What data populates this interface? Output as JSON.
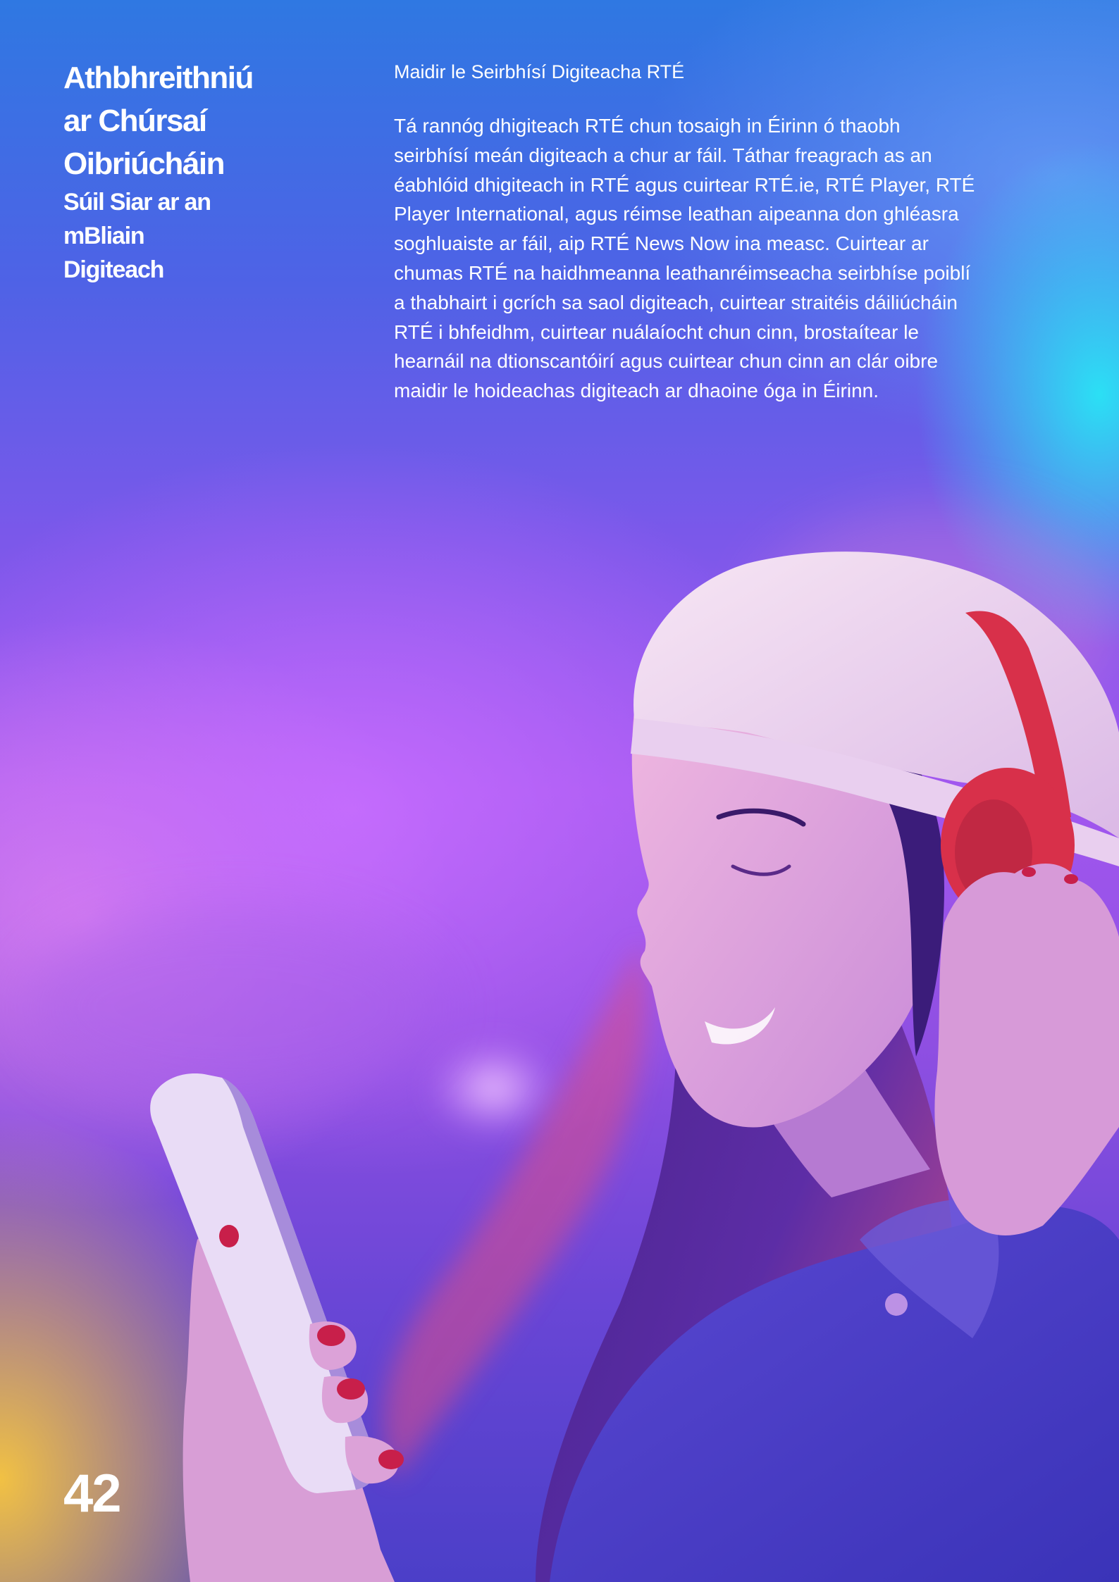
{
  "header": {
    "title_lines": [
      "Athbhreithniú",
      "ar Chúrsaí",
      "Oibriúcháin"
    ],
    "subtitle_lines": [
      "Súil Siar ar an",
      "mBliain",
      "Digiteach"
    ]
  },
  "article": {
    "kicker": "Maidir le Seirbhísí Digiteacha RTÉ",
    "body_lines": [
      "Tá rannóg dhigiteach RTÉ chun tosaigh in Éirinn ó thaobh",
      "seirbhísí meán digiteach a chur ar fáil. Táthar freagrach as an",
      "éabhlóid dhigiteach in RTÉ agus cuirtear RTÉ.ie, RTÉ Player, RTÉ",
      "Player International, agus réimse leathan aipeanna don ghléasra",
      "soghluaiste ar fáil, aip RTÉ News Now ina measc. Cuirtear ar",
      "chumas RTÉ na haidhmeanna leathanréimseacha seirbhíse poiblí",
      "a thabhairt i gcrích sa saol digiteach, cuirtear straitéis dáiliúcháin",
      "RTÉ i bhfeidhm, cuirtear nuálaíocht chun cinn, brostaítear le",
      "hearnáil na dtionscantóirí agus cuirtear chun cinn an clár oibre",
      "maidir le hoideachas digiteach ar dhaoine óga in Éirinn."
    ]
  },
  "footer": {
    "page_number": "42"
  },
  "photo": {
    "subject": "woman-with-headphones-and-phone",
    "colors": {
      "hat": "#f3dff0",
      "headphones": "#e0344f",
      "hair": "#4a2080",
      "skin": "#e9a8cf",
      "jacket": "#4d3ac2",
      "phone": "#e7dcf6",
      "nails": "#c81f4a"
    }
  }
}
